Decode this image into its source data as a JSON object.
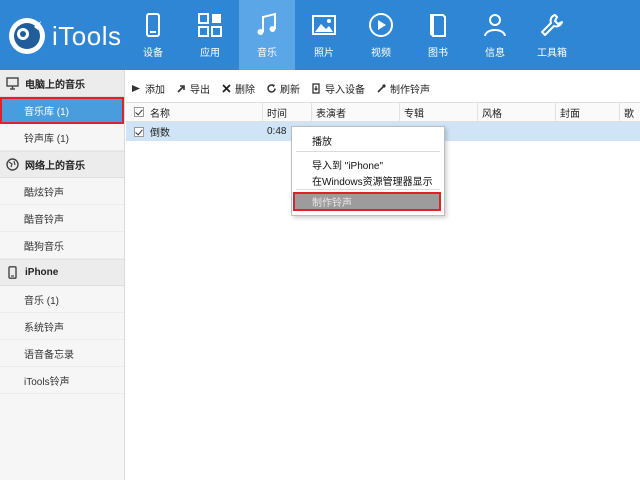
{
  "app": {
    "name": "iTools"
  },
  "nav": [
    {
      "label": "设备",
      "icon": "device-icon"
    },
    {
      "label": "应用",
      "icon": "apps-icon"
    },
    {
      "label": "音乐",
      "icon": "music-icon",
      "active": true
    },
    {
      "label": "照片",
      "icon": "photo-icon"
    },
    {
      "label": "视频",
      "icon": "video-icon"
    },
    {
      "label": "图书",
      "icon": "book-icon"
    },
    {
      "label": "信息",
      "icon": "user-icon"
    },
    {
      "label": "工具箱",
      "icon": "tools-icon"
    }
  ],
  "sidebar": {
    "sections": [
      {
        "title": "电脑上的音乐",
        "icon": "computer-icon",
        "items": [
          "音乐库 (1)",
          "铃声库 (1)"
        ]
      },
      {
        "title": "网络上的音乐",
        "icon": "globe-icon",
        "items": [
          "酷炫铃声",
          "酷音铃声",
          "酷狗音乐"
        ]
      },
      {
        "title": "iPhone",
        "icon": "phone-icon",
        "items": [
          "音乐 (1)",
          "系统铃声",
          "语音备忘录",
          "iTools铃声"
        ]
      }
    ],
    "selected": "音乐库 (1)"
  },
  "toolbar": {
    "add": "添加",
    "export": "导出",
    "delete": "删除",
    "refresh": "刷新",
    "import_device": "导入设备",
    "make_ringtone": "制作铃声"
  },
  "table": {
    "columns": [
      "名称",
      "时间",
      "表演者",
      "专辑",
      "风格",
      "封面",
      "歌"
    ],
    "rows": [
      {
        "name": "倒数",
        "time": "0:48",
        "checked": true
      }
    ]
  },
  "context_menu": {
    "items": [
      "播放",
      "导入到 \"iPhone\"",
      "在Windows资源管理器显示",
      "制作铃声"
    ]
  },
  "colors": {
    "header": "#2f86d4",
    "active_tab": "#5aa6e6",
    "selected_item": "#4a9ddd",
    "highlight_border": "#e0202a",
    "row_selected": "#cfe4f6"
  }
}
